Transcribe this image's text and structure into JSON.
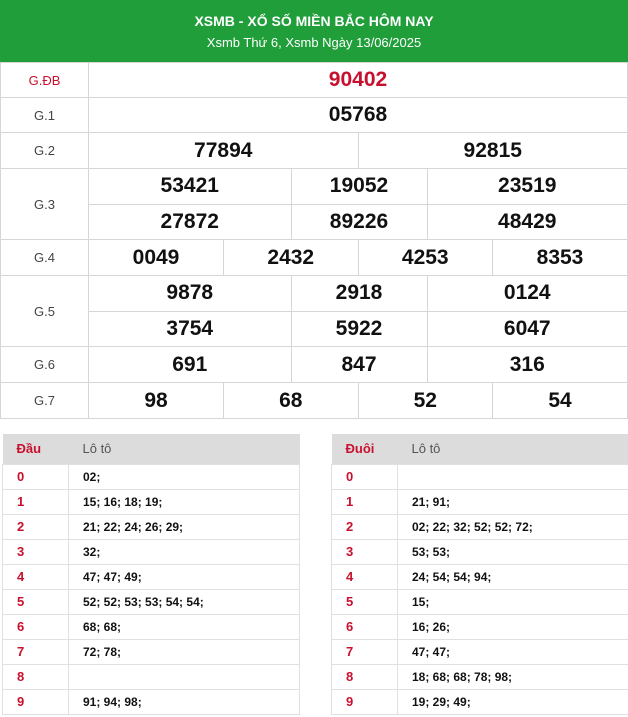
{
  "header": {
    "title": "XSMB - XỔ SỐ MIỀN BẮC HÔM NAY",
    "subtitle": "Xsmb Thứ 6, Xsmb Ngày 13/06/2025"
  },
  "prizes": {
    "gdb": {
      "label": "G.ĐB",
      "numbers": [
        "90402"
      ]
    },
    "g1": {
      "label": "G.1",
      "numbers": [
        "05768"
      ]
    },
    "g2": {
      "label": "G.2",
      "numbers": [
        "77894",
        "92815"
      ]
    },
    "g3": {
      "label": "G.3",
      "numbers": [
        "53421",
        "19052",
        "23519",
        "27872",
        "89226",
        "48429"
      ]
    },
    "g4": {
      "label": "G.4",
      "numbers": [
        "0049",
        "2432",
        "4253",
        "8353"
      ]
    },
    "g5": {
      "label": "G.5",
      "numbers": [
        "9878",
        "2918",
        "0124",
        "3754",
        "5922",
        "6047"
      ]
    },
    "g6": {
      "label": "G.6",
      "numbers": [
        "691",
        "847",
        "316"
      ]
    },
    "g7": {
      "label": "G.7",
      "numbers": [
        "98",
        "68",
        "52",
        "54"
      ]
    }
  },
  "loto_head": {
    "col_key": "Đầu",
    "col_val": "Lô tô",
    "rows": [
      {
        "key": "0",
        "val": "02;"
      },
      {
        "key": "1",
        "val": "15; 16; 18; 19;"
      },
      {
        "key": "2",
        "val": "21; 22; 24; 26; 29;"
      },
      {
        "key": "3",
        "val": "32;"
      },
      {
        "key": "4",
        "val": "47; 47; 49;"
      },
      {
        "key": "5",
        "val": "52; 52; 53; 53; 54; 54;"
      },
      {
        "key": "6",
        "val": "68; 68;"
      },
      {
        "key": "7",
        "val": "72; 78;"
      },
      {
        "key": "8",
        "val": ""
      },
      {
        "key": "9",
        "val": "91; 94; 98;"
      }
    ]
  },
  "loto_tail": {
    "col_key": "Đuôi",
    "col_val": "Lô tô",
    "rows": [
      {
        "key": "0",
        "val": ""
      },
      {
        "key": "1",
        "val": "21; 91;"
      },
      {
        "key": "2",
        "val": "02; 22; 32; 52; 52; 72;"
      },
      {
        "key": "3",
        "val": "53; 53;"
      },
      {
        "key": "4",
        "val": "24; 54; 54; 94;"
      },
      {
        "key": "5",
        "val": "15;"
      },
      {
        "key": "6",
        "val": "16; 26;"
      },
      {
        "key": "7",
        "val": "47; 47;"
      },
      {
        "key": "8",
        "val": "18; 68; 68; 78; 98;"
      },
      {
        "key": "9",
        "val": "19; 29; 49;"
      }
    ]
  },
  "colors": {
    "header_bg": "#1f9e3a",
    "accent_red": "#c8102e"
  }
}
